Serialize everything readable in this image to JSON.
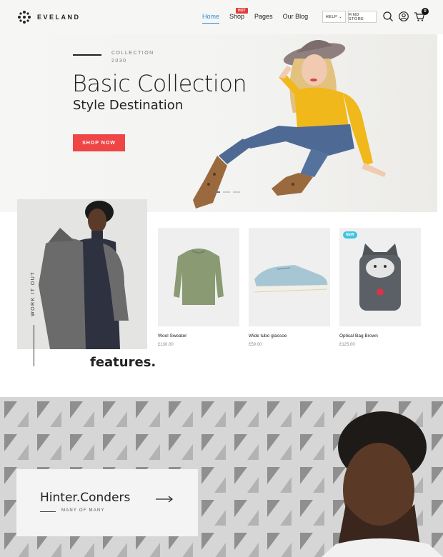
{
  "header": {
    "brand": "EVELAND",
    "nav": [
      "Home",
      "Shop",
      "Pages",
      "Our Blog"
    ],
    "hot_badge": "HOT",
    "help_label": "HELP ⌄",
    "find_store_label": "FIND STORE",
    "cart_count": "0",
    "icons": [
      "search-icon",
      "user-icon",
      "cart-icon"
    ],
    "accent": "#2f8fd6"
  },
  "hero": {
    "collection_line1": "COLLECTION",
    "collection_line2": "2030",
    "title": "Basic Collection",
    "subtitle": "Style Destination",
    "cta": "SHOP NOW",
    "cta_color": "#f04545"
  },
  "features": {
    "vertical_label": "WORK IT OUT",
    "heading": "features.",
    "new_badge": "NEW",
    "products": [
      {
        "name": "Wool Sweater",
        "price": "£130.00"
      },
      {
        "name": "Wide tubo glassoe",
        "price": "£59.00"
      },
      {
        "name": "Optical Bag Brown",
        "price": "£125.00"
      }
    ]
  },
  "banner": {
    "name": "Hinter.Conders",
    "subtitle": "MANY OF MANY"
  }
}
